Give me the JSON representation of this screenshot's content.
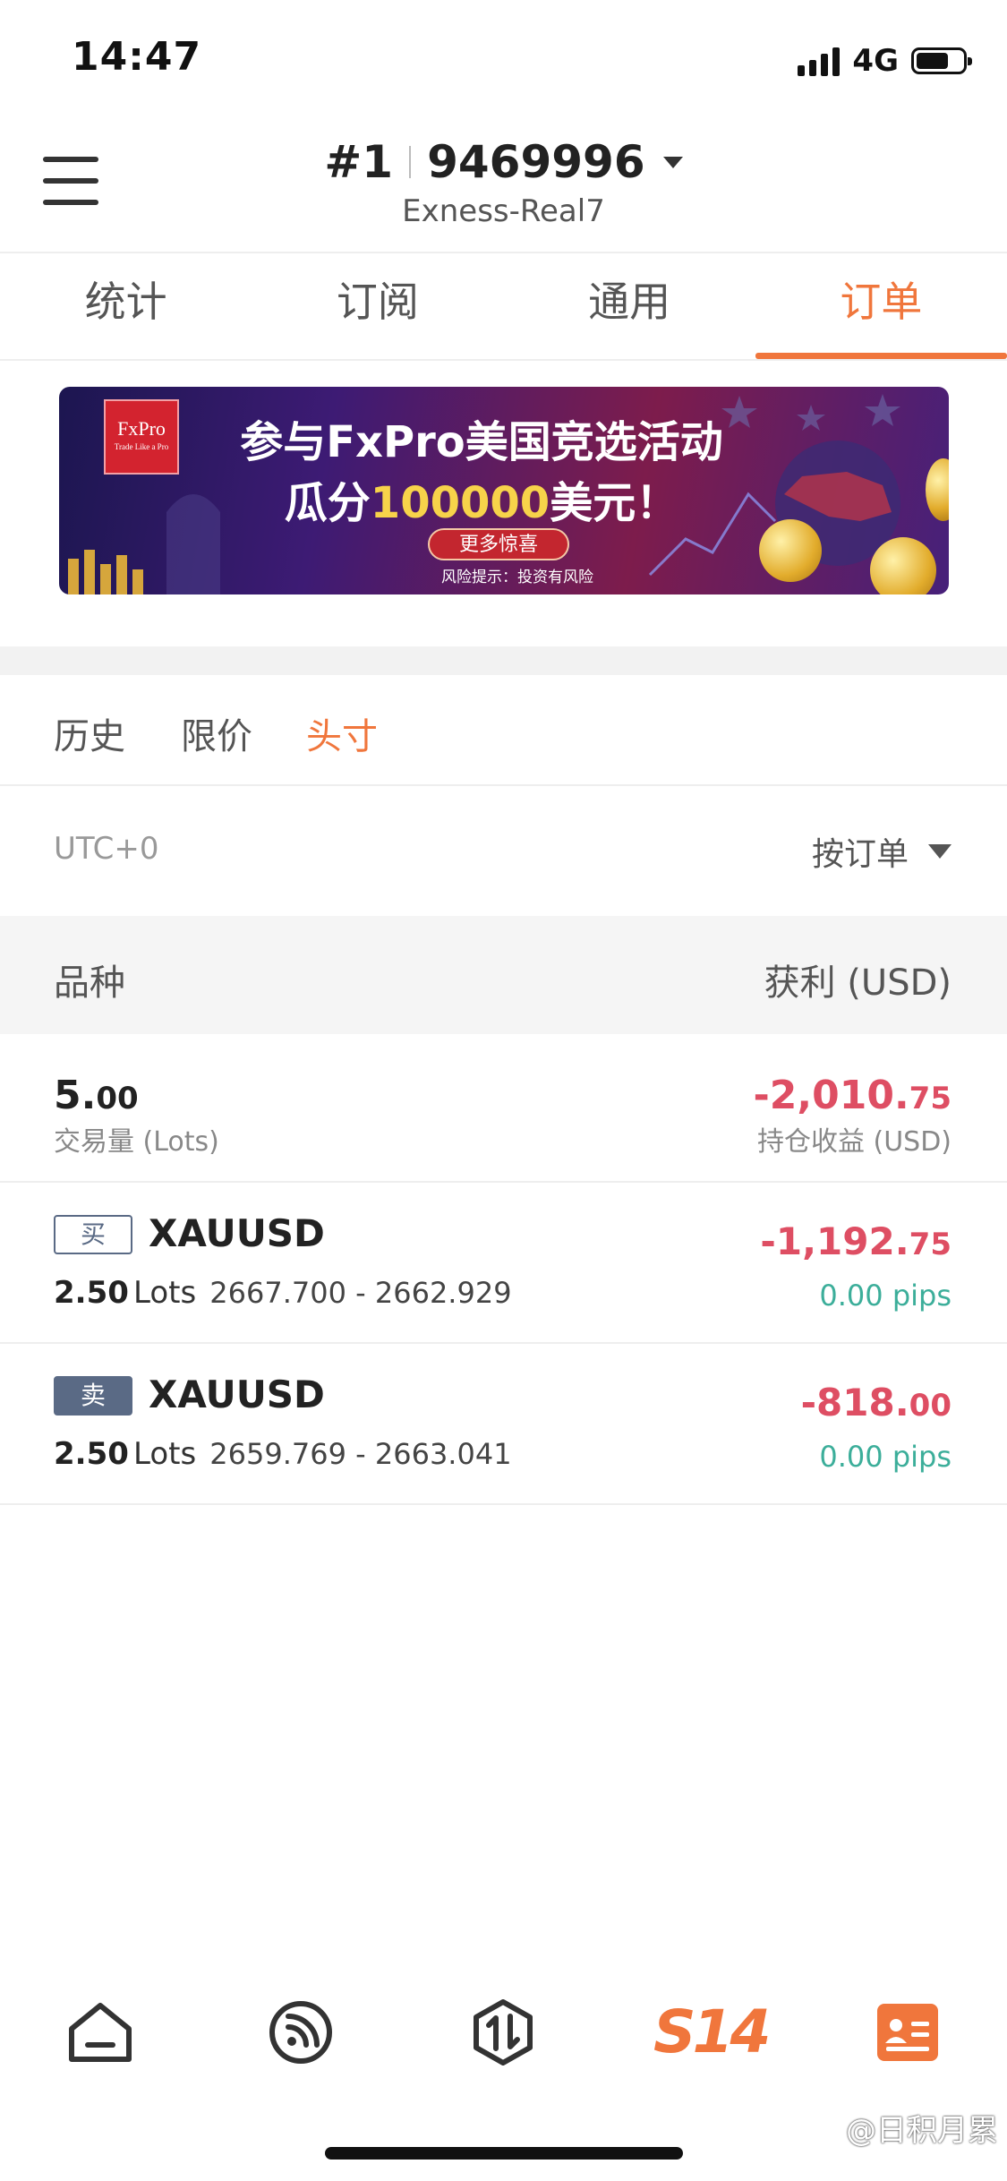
{
  "status_bar": {
    "time": "14:47",
    "network": "4G"
  },
  "header": {
    "account_prefix": "#1",
    "account_number": "9469996",
    "server": "Exness-Real7"
  },
  "tabs": [
    {
      "label": "统计",
      "active": false
    },
    {
      "label": "订阅",
      "active": false
    },
    {
      "label": "通用",
      "active": false
    },
    {
      "label": "订单",
      "active": true
    }
  ],
  "banner": {
    "logo_text": "FxPro",
    "logo_tagline": "Trade Like a Pro",
    "line1": "参与FxPro美国竞选活动",
    "line2_prefix": "瓜分",
    "line2_amount": "100000",
    "line2_suffix": "美元！",
    "button": "更多惊喜",
    "risk_note": "风险提示：投资有风险"
  },
  "sub_tabs": [
    {
      "label": "历史",
      "active": false
    },
    {
      "label": "限价",
      "active": false
    },
    {
      "label": "头寸",
      "active": true
    }
  ],
  "filter": {
    "timezone": "UTC+0",
    "sort_label": "按订单"
  },
  "table_header": {
    "left": "品种",
    "right": "获利 (USD)"
  },
  "summary": {
    "volume_main": "5.",
    "volume_decimal": "00",
    "volume_label": "交易量 (Lots)",
    "pnl_main": "-2,010.",
    "pnl_decimal": "75",
    "pnl_label": "持仓收益 (USD)"
  },
  "positions": [
    {
      "side": "买",
      "symbol": "XAUUSD",
      "lots": "2.50",
      "lots_unit": "Lots",
      "prices": "2667.700 - 2662.929",
      "pnl_main": "-1,192.",
      "pnl_decimal": "75",
      "pips": "0.00 pips"
    },
    {
      "side": "卖",
      "symbol": "XAUUSD",
      "lots": "2.50",
      "lots_unit": "Lots",
      "prices": "2659.769 - 2663.041",
      "pnl_main": "-818.",
      "pnl_decimal": "00",
      "pips": "0.00 pips"
    }
  ],
  "bottom_nav": {
    "items": [
      {
        "icon": "home-icon"
      },
      {
        "icon": "signal-feed-icon"
      },
      {
        "icon": "trade-icon"
      },
      {
        "icon": "s14-logo",
        "label": "S14"
      },
      {
        "icon": "account-card-icon"
      }
    ]
  },
  "watermark": "@日积月累",
  "colors": {
    "accent": "#f0763c",
    "loss": "#de4e63",
    "pips": "#3cae9a",
    "badge": "#5a6a85"
  }
}
